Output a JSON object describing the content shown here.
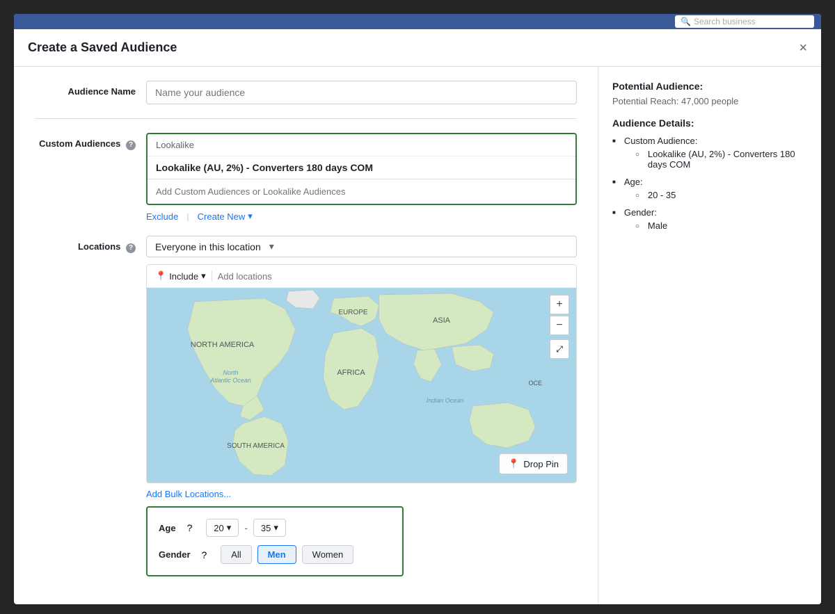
{
  "topbar": {
    "search_placeholder": "Search business"
  },
  "modal": {
    "title": "Create a Saved Audience",
    "close_label": "×"
  },
  "form": {
    "audience_name_label": "Audience Name",
    "audience_name_placeholder": "Name your audience",
    "custom_audiences_label": "Custom Audiences",
    "custom_audiences_help": "?",
    "lookalike_tag": "Lookalike",
    "lookalike_selected": "Lookalike (AU, 2%) - Converters 180 days COM",
    "audience_add_placeholder": "Add Custom Audiences or Lookalike Audiences",
    "exclude_label": "Exclude",
    "create_new_label": "Create New",
    "locations_label": "Locations",
    "locations_help": "?",
    "location_dropdown": "Everyone in this location",
    "include_label": "Include",
    "add_locations_placeholder": "Add locations",
    "drop_pin_label": "Drop Pin",
    "add_bulk_label": "Add Bulk Locations...",
    "age_label": "Age",
    "age_help": "?",
    "age_min": "20",
    "age_max": "35",
    "age_dash": "-",
    "gender_label": "Gender",
    "gender_help": "?",
    "gender_options": [
      "All",
      "Men",
      "Women"
    ],
    "gender_active": "Men",
    "map_labels": {
      "north_america": "NORTH AMERICA",
      "south_america": "SOUTH AMERICA",
      "europe": "EUROPE",
      "africa": "AFRICA",
      "asia": "ASIA",
      "north_atlantic": "North\nAtlantic Ocean",
      "indian_ocean": "Indian Ocean",
      "oce": "OCE"
    }
  },
  "sidebar": {
    "potential_audience_label": "Potential Audience:",
    "potential_reach_label": "Potential Reach: 47,000 people",
    "audience_details_label": "Audience Details:",
    "details": {
      "custom_audience_label": "Custom Audience:",
      "custom_audience_sub": "Lookalike (AU, 2%) - Converters 180 days COM",
      "age_label": "Age:",
      "age_value": "20 - 35",
      "gender_label": "Gender:",
      "gender_value": "Male"
    }
  },
  "icons": {
    "close": "×",
    "chevron_down": "▾",
    "pin": "📍",
    "plus": "+",
    "minus": "−",
    "expand": "⤢",
    "search": "🔍"
  }
}
